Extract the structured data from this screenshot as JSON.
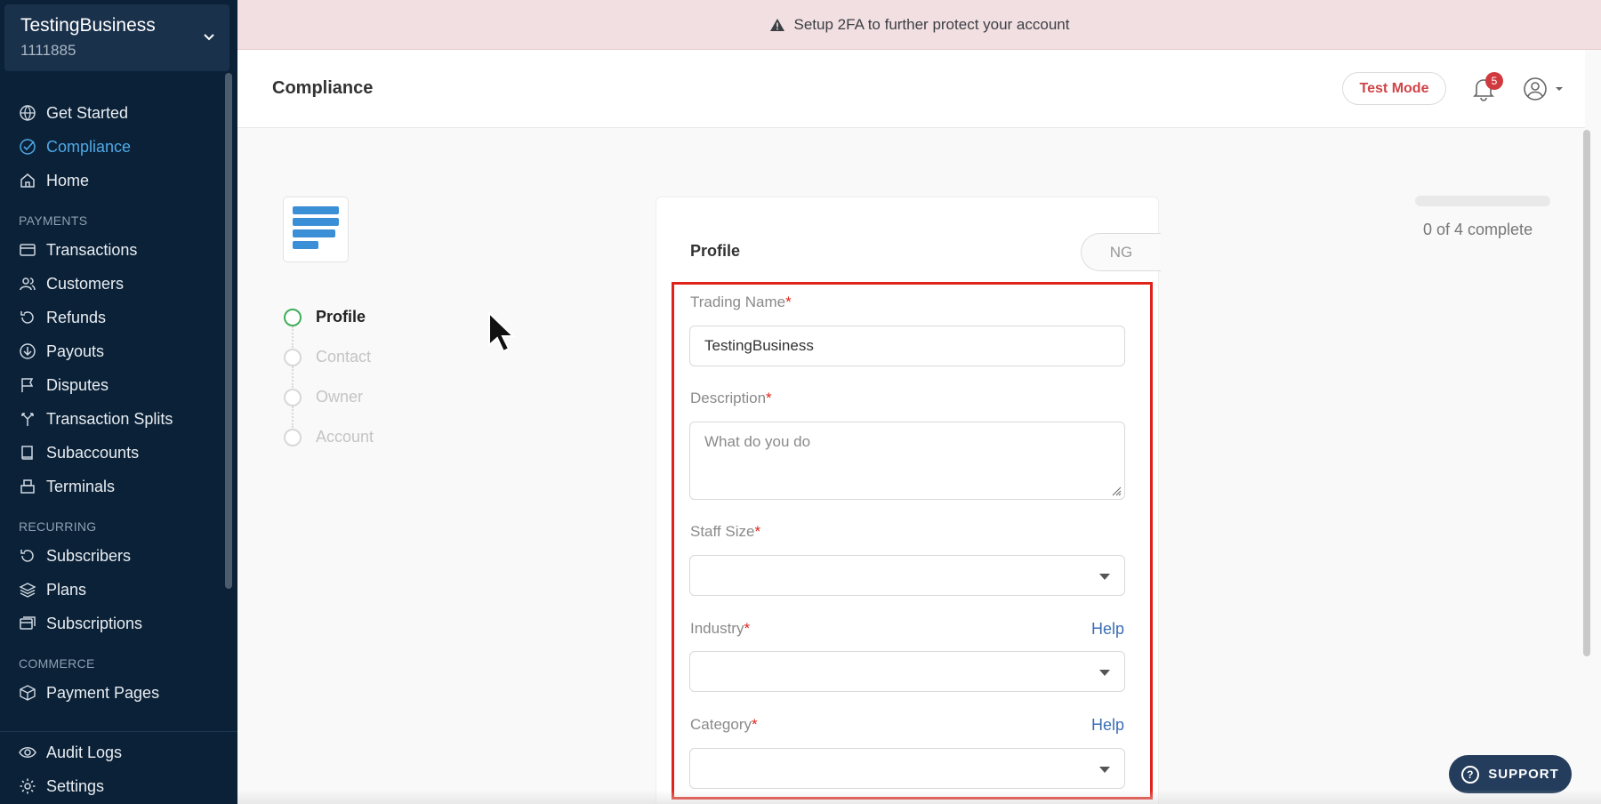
{
  "business": {
    "name": "TestingBusiness",
    "id": "1111885"
  },
  "nav": {
    "top": [
      {
        "label": "Get Started",
        "icon": "globe-icon"
      },
      {
        "label": "Compliance",
        "icon": "check-circle-icon",
        "active": true
      },
      {
        "label": "Home",
        "icon": "home-icon"
      }
    ],
    "payments_label": "PAYMENTS",
    "payments": [
      {
        "label": "Transactions",
        "icon": "card-icon"
      },
      {
        "label": "Customers",
        "icon": "users-icon"
      },
      {
        "label": "Refunds",
        "icon": "refund-icon"
      },
      {
        "label": "Payouts",
        "icon": "payout-icon"
      },
      {
        "label": "Disputes",
        "icon": "flag-icon"
      },
      {
        "label": "Transaction Splits",
        "icon": "split-icon"
      },
      {
        "label": "Subaccounts",
        "icon": "book-icon"
      },
      {
        "label": "Terminals",
        "icon": "terminal-icon"
      }
    ],
    "recurring_label": "RECURRING",
    "recurring": [
      {
        "label": "Subscribers",
        "icon": "refresh-icon"
      },
      {
        "label": "Plans",
        "icon": "layers-icon"
      },
      {
        "label": "Subscriptions",
        "icon": "subscriptions-icon"
      }
    ],
    "commerce_label": "COMMERCE",
    "commerce": [
      {
        "label": "Payment Pages",
        "icon": "box-icon"
      }
    ],
    "bottom": [
      {
        "label": "Audit Logs",
        "icon": "eye-icon"
      },
      {
        "label": "Settings",
        "icon": "gear-icon"
      }
    ]
  },
  "banner": {
    "text": "Setup 2FA to further protect your account"
  },
  "header": {
    "title": "Compliance",
    "test_mode": "Test Mode",
    "notifications": "5"
  },
  "steps": [
    {
      "label": "Profile",
      "active": true
    },
    {
      "label": "Contact"
    },
    {
      "label": "Owner"
    },
    {
      "label": "Account"
    }
  ],
  "form": {
    "title": "Profile",
    "country": "NG",
    "trading_name_label": "Trading Name",
    "trading_name_value": "TestingBusiness",
    "description_label": "Description",
    "description_placeholder": "What do you do",
    "staff_size_label": "Staff Size",
    "industry_label": "Industry",
    "category_label": "Category",
    "help": "Help",
    "required_mark": "*"
  },
  "progress": {
    "text": "0 of 4 complete",
    "value": 0
  },
  "support": {
    "label": "SUPPORT"
  },
  "colors": {
    "sidebar_bg": "#0b2137",
    "accent_blue": "#4ea8e6",
    "danger": "#e0231a",
    "active_step": "#3fae5a"
  }
}
